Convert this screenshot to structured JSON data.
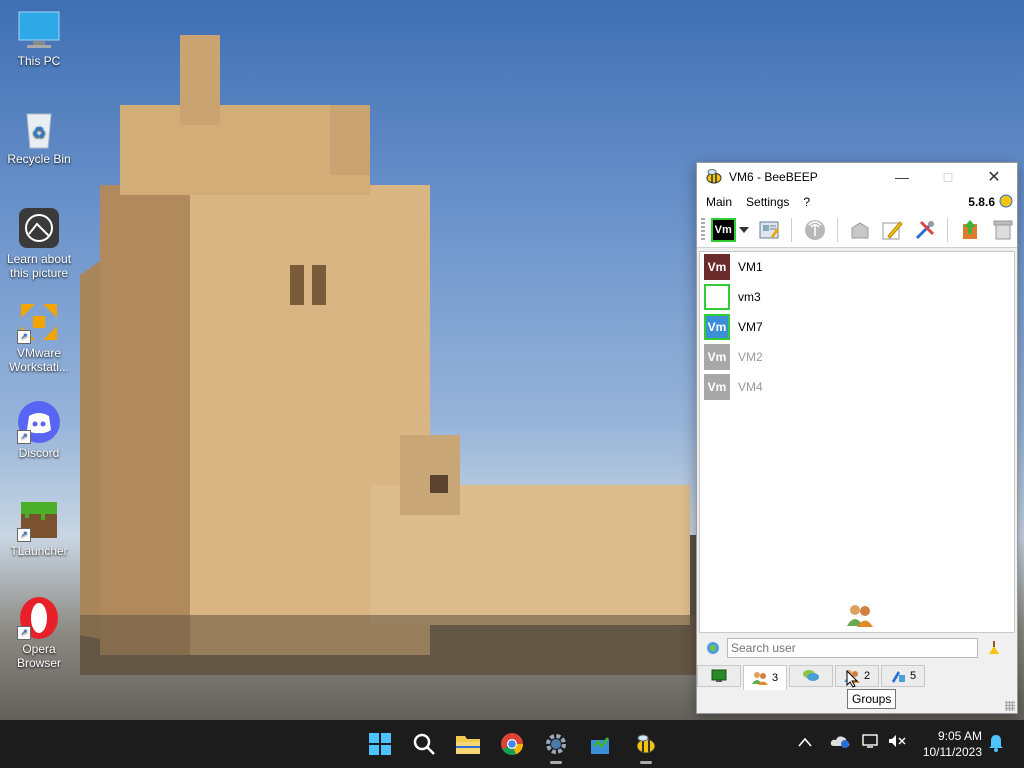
{
  "desktop": {
    "icons": [
      {
        "label": "This PC",
        "icon": "monitor-icon"
      },
      {
        "label": "Recycle Bin",
        "icon": "recycle-bin-icon"
      },
      {
        "label": "Learn about this picture",
        "icon": "camera-icon"
      },
      {
        "label": "VMware Workstati...",
        "icon": "vmware-icon"
      },
      {
        "label": "Discord",
        "icon": "discord-icon"
      },
      {
        "label": "TLauncher",
        "icon": "grass-block-icon"
      },
      {
        "label": "Opera Browser",
        "icon": "opera-icon"
      }
    ]
  },
  "window": {
    "title": "VM6 - BeeBEEP",
    "version": "5.8.6",
    "menu": [
      "Main",
      "Settings",
      "?"
    ],
    "status_avatar": "Vm",
    "users": [
      {
        "initials": "Vm",
        "name": "VM1",
        "status": "busy",
        "color": "#6b2b2b",
        "border": "#6b2b2b"
      },
      {
        "initials": "",
        "name": "vm3",
        "status": "online",
        "color": "#ffffff",
        "border": "#33cc33"
      },
      {
        "initials": "Vm",
        "name": "VM7",
        "status": "online",
        "color": "#3a8fd8",
        "border": "#33cc33"
      },
      {
        "initials": "Vm",
        "name": "VM2",
        "status": "offline",
        "color": "#a8a8a8",
        "border": "#a8a8a8"
      },
      {
        "initials": "Vm",
        "name": "VM4",
        "status": "offline",
        "color": "#a8a8a8",
        "border": "#a8a8a8"
      }
    ],
    "search_placeholder": "Search user",
    "tabs": [
      {
        "icon": "screen-icon",
        "count": ""
      },
      {
        "icon": "users-icon",
        "count": "3"
      },
      {
        "icon": "chat-icon",
        "count": ""
      },
      {
        "icon": "groups-icon",
        "count": "2"
      },
      {
        "icon": "files-icon",
        "count": "5"
      }
    ],
    "tooltip": "Groups"
  },
  "taskbar": {
    "time": "9:05 AM",
    "date": "10/11/2023"
  }
}
